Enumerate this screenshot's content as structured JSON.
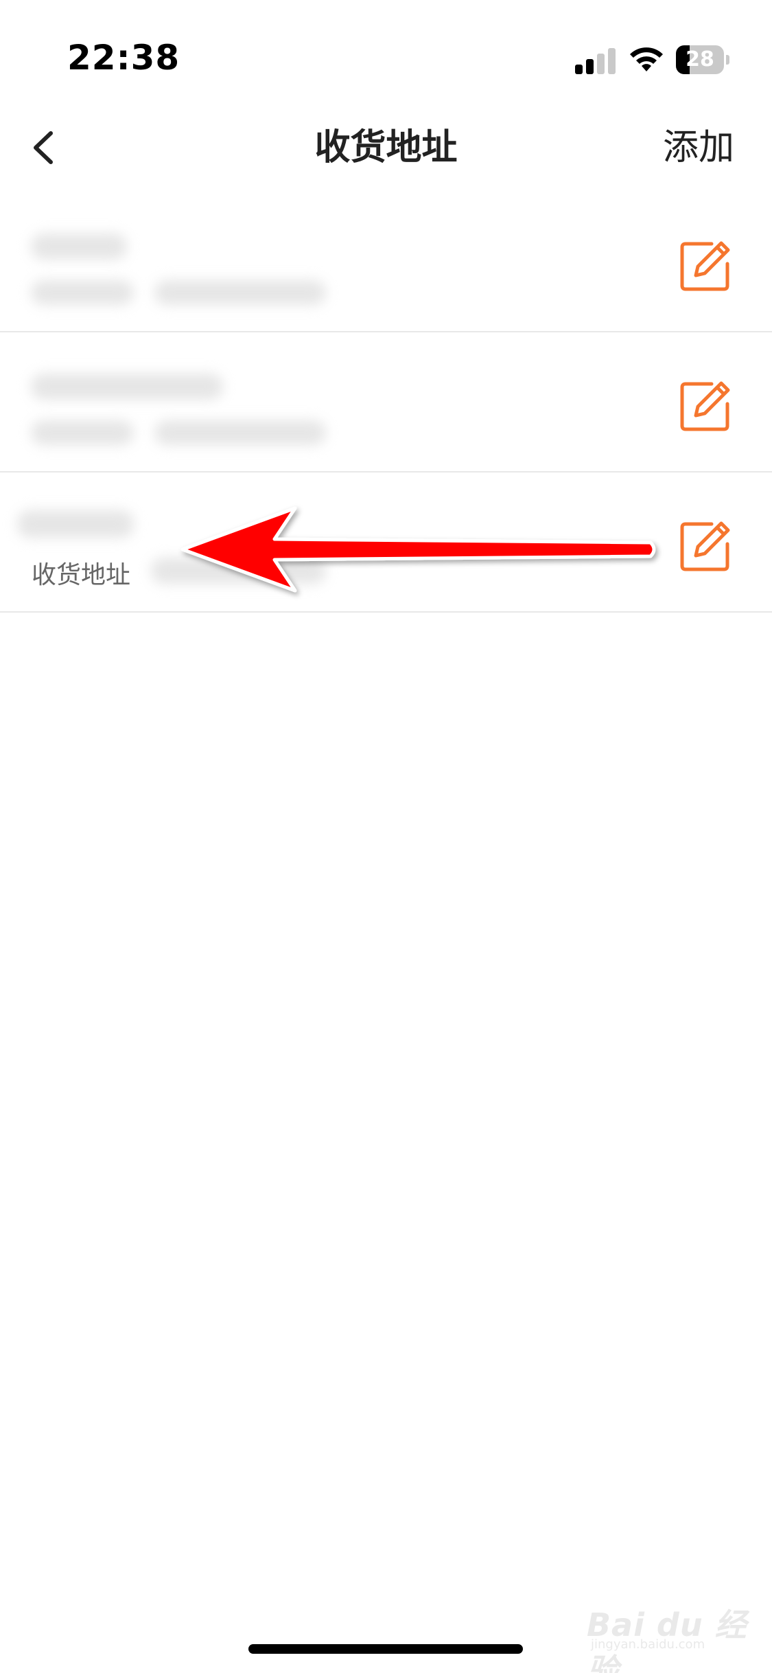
{
  "status_bar": {
    "time": "22:38",
    "battery_level": "28",
    "battery_fraction": 0.28,
    "signal_bars_active": 2,
    "signal_bars_total": 4
  },
  "nav": {
    "title": "收货地址",
    "add_label": "添加"
  },
  "addresses": [
    {
      "label": "",
      "obscured": true
    },
    {
      "label": "",
      "obscured": true
    },
    {
      "label": "收货地址",
      "obscured": true
    }
  ],
  "colors": {
    "accent": "#f5762e",
    "arrow": "#ff0000",
    "divider": "#e8e8e8",
    "title_text": "#222222",
    "secondary_text": "#666666"
  },
  "icons": {
    "back": "chevron-left-icon",
    "edit": "edit-pencil-icon",
    "wifi": "wifi-icon",
    "signal": "signal-icon",
    "battery": "battery-icon"
  },
  "watermark": {
    "brand": "Bai du 经验",
    "sub": "jingyan.baidu.com"
  }
}
